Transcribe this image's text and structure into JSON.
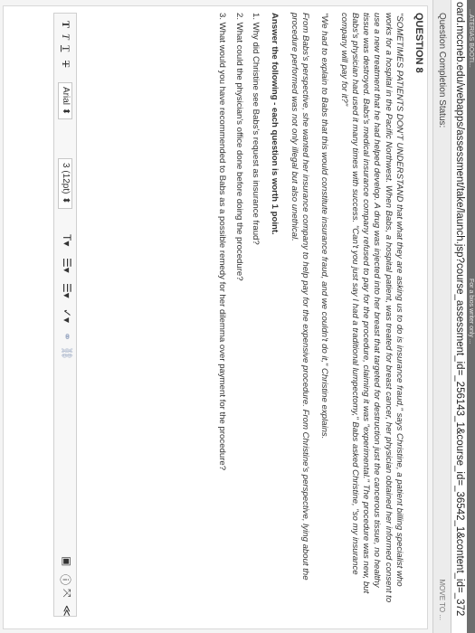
{
  "browser": {
    "tabs": [
      "...ATERIAS BOOTI...",
      "For a bios writer only  ..."
    ],
    "url": "oard.mccneb.edu/webapps/assessment/take/launch.jsp?course_assessment_id=_256143_1&course_id=_36542_1&content_id=_372"
  },
  "status": {
    "label": "Question Completion Status:",
    "right_text": "MOVE TO ..."
  },
  "question": {
    "title": "QUESTION 8",
    "p1": "\"SOMETIMES PATIENTS DON'T UNDERSTAND that what they are asking us to do is insurance fraud,\" says Christine, a patient billing specialist who works for a hospital in the Pacific Northwest. When Babs, a hospital patient, was treated for breast cancer, her physician obtained her informed consent to use a new treatment that he had helped develop. A drug was injected into her breast that targeted for destruction just the cancerous tissue, no healthy tissue was destroyed. Babs's medical insurance company refused to pay for the procedure, claiming it was \"experimental.\" The procedure was new, but Babs's physician had used it many times with success. \"Can't you just say I had a traditional lumpectomy,\" Babs asked Christine, \"so my insurance company will pay for it?\"",
    "p2": "\"We had to explain to Babs that this would constitute insurance fraud, and we couldn't do it,\" Christine explains.",
    "p3": "From Babs's perspective, she wanted her insurance company to help pay for the expensive procedure.  From Christine's perspective, lying about the procedure performed was not only illegal but also unethical.",
    "instruction": "Answer the following - each question is worth 1 point.",
    "items": [
      "1. Why did Christine see Babs's request as insurance fraud?",
      "2. What could the physician's office done before doing the procedure?",
      "3. What would you have recommended to Babs as a possible remedy for her dilemma over payment for the procedure?"
    ]
  },
  "editor": {
    "font_family": "Arial",
    "font_size": "3 (12pt)"
  }
}
